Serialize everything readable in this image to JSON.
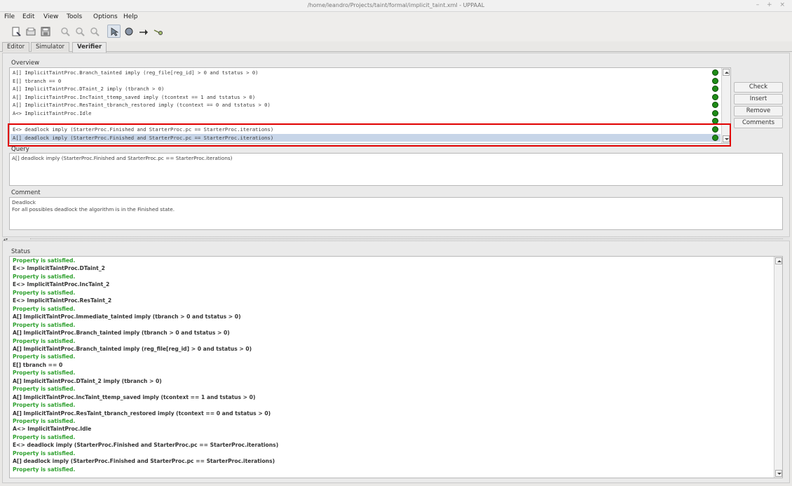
{
  "window": {
    "title": "/home/leandro/Projects/taint/formal/implicit_taint.xml - UPPAAL",
    "controls": "– + ×"
  },
  "menu": [
    "File",
    "Edit",
    "View",
    "Tools",
    "Options",
    "Help"
  ],
  "toolbar": {
    "icons": [
      "new-document-icon",
      "open-icon",
      "save-icon",
      "zoom-fit-icon",
      "zoom-in-icon",
      "zoom-out-icon",
      "select-tool-icon",
      "location-tool-icon",
      "edge-tool-icon",
      "nail-tool-icon"
    ]
  },
  "tabs": [
    {
      "label": "Editor",
      "active": false
    },
    {
      "label": "Simulator",
      "active": false
    },
    {
      "label": "Verifier",
      "active": true
    }
  ],
  "overview": {
    "label": "Overview",
    "queries": [
      {
        "text": "A[] ImplicitTaintProc.Branch_tainted imply (reg_file[reg_id] > 0 and tstatus > 0)",
        "status": "satisfied",
        "selected": false
      },
      {
        "text": "E[] tbranch == 0",
        "status": "satisfied",
        "selected": false
      },
      {
        "text": "A[] ImplicitTaintProc.DTaint_2 imply (tbranch > 0)",
        "status": "satisfied",
        "selected": false
      },
      {
        "text": "A[] ImplicitTaintProc.IncTaint_ttemp_saved imply (tcontext == 1 and tstatus > 0)",
        "status": "satisfied",
        "selected": false
      },
      {
        "text": "A[] ImplicitTaintProc.ResTaint_tbranch_restored imply (tcontext == 0 and tstatus > 0)",
        "status": "satisfied",
        "selected": false
      },
      {
        "text": "A<> ImplicitTaintProc.Idle",
        "status": "satisfied",
        "selected": false
      },
      {
        "text": "E<> deadlock imply (StarterProc.Finished and StarterProc.pc == StarterProc.iterations)",
        "status": "satisfied",
        "selected": false
      },
      {
        "text": "A[] deadlock imply (StarterProc.Finished and StarterProc.pc == StarterProc.iterations)",
        "status": "satisfied",
        "selected": true
      }
    ],
    "status_color": "#1e8c17",
    "highlight_color": "#e10000"
  },
  "buttons": {
    "check": "Check",
    "insert": "Insert",
    "remove": "Remove",
    "comments": "Comments"
  },
  "query": {
    "label": "Query",
    "value": "A[] deadlock imply (StarterProc.Finished and StarterProc.pc == StarterProc.iterations)"
  },
  "comment": {
    "label": "Comment",
    "line1": "Deadlock",
    "line2": "For all possibles deadlock the algorithm is in the Finished state."
  },
  "status": {
    "label": "Status",
    "ok_color": "#2ea02e",
    "lines": [
      {
        "text": "Property is satisfied.",
        "kind": "ok"
      },
      {
        "text": "E<> ImplicitTaintProc.DTaint_2",
        "kind": "q"
      },
      {
        "text": "Property is satisfied.",
        "kind": "ok"
      },
      {
        "text": "E<> ImplicitTaintProc.IncTaint_2",
        "kind": "q"
      },
      {
        "text": "Property is satisfied.",
        "kind": "ok"
      },
      {
        "text": "E<> ImplicitTaintProc.ResTaint_2",
        "kind": "q"
      },
      {
        "text": "Property is satisfied.",
        "kind": "ok"
      },
      {
        "text": "A[] ImplicitTaintProc.Immediate_tainted imply (tbranch > 0 and tstatus > 0)",
        "kind": "q"
      },
      {
        "text": "Property is satisfied.",
        "kind": "ok"
      },
      {
        "text": "A[] ImplicitTaintProc.Branch_tainted imply (tbranch > 0 and tstatus > 0)",
        "kind": "q"
      },
      {
        "text": "Property is satisfied.",
        "kind": "ok"
      },
      {
        "text": "A[] ImplicitTaintProc.Branch_tainted imply (reg_file[reg_id] > 0 and tstatus > 0)",
        "kind": "q"
      },
      {
        "text": "Property is satisfied.",
        "kind": "ok"
      },
      {
        "text": "E[] tbranch == 0",
        "kind": "q"
      },
      {
        "text": "Property is satisfied.",
        "kind": "ok"
      },
      {
        "text": "A[] ImplicitTaintProc.DTaint_2 imply (tbranch > 0)",
        "kind": "q"
      },
      {
        "text": "Property is satisfied.",
        "kind": "ok"
      },
      {
        "text": "A[] ImplicitTaintProc.IncTaint_ttemp_saved imply (tcontext == 1 and tstatus > 0)",
        "kind": "q"
      },
      {
        "text": "Property is satisfied.",
        "kind": "ok"
      },
      {
        "text": "A[] ImplicitTaintProc.ResTaint_tbranch_restored imply (tcontext == 0 and tstatus > 0)",
        "kind": "q"
      },
      {
        "text": "Property is satisfied.",
        "kind": "ok"
      },
      {
        "text": "A<> ImplicitTaintProc.Idle",
        "kind": "q"
      },
      {
        "text": "Property is satisfied.",
        "kind": "ok"
      },
      {
        "text": "E<> deadlock imply (StarterProc.Finished and StarterProc.pc == StarterProc.iterations)",
        "kind": "q"
      },
      {
        "text": "Property is satisfied.",
        "kind": "ok"
      },
      {
        "text": "A[] deadlock imply (StarterProc.Finished and StarterProc.pc == StarterProc.iterations)",
        "kind": "q"
      },
      {
        "text": "Property is satisfied.",
        "kind": "ok"
      }
    ]
  }
}
